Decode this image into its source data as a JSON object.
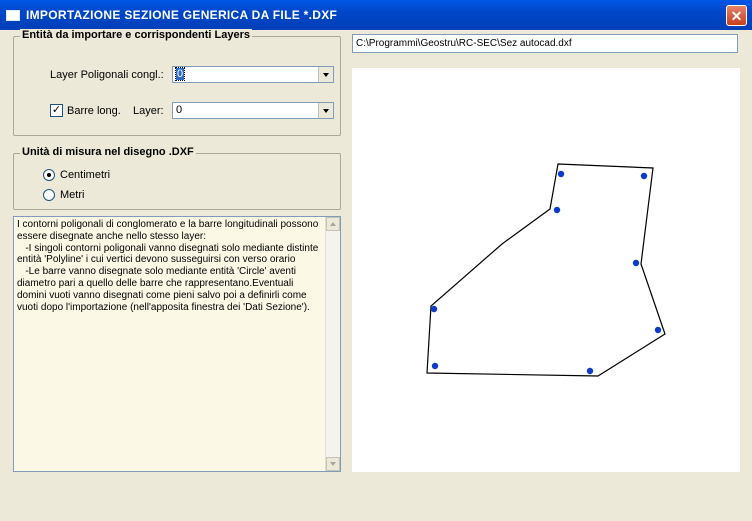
{
  "window": {
    "title": "IMPORTAZIONE  SEZIONE GENERICA  DA  FILE  *.DXF",
    "close_glyph": "✕"
  },
  "entities_group": {
    "legend": "Entità da importare e corrispondenti  Layers",
    "layer_label": "Layer Poligonali congl.:",
    "layer_value": "0",
    "bars_checkbox_label": "Barre long.",
    "bars_checked": true,
    "bars_layer_label": "Layer:",
    "bars_layer_value": "0"
  },
  "units_group": {
    "legend": "Unità di misura nel disegno .DXF",
    "options": [
      {
        "label": "Centimetri",
        "selected": true
      },
      {
        "label": "Metri",
        "selected": false
      }
    ]
  },
  "info_text": "I contorni poligonali di conglomerato e la barre longitudinali possono essere disegnate anche nello stesso layer:\n   -I singoli contorni poligonali vanno disegnati solo mediante distinte entità 'Polyline' i cui vertici devono susseguirsi con verso orario\n   -Le barre vanno disegnate solo mediante entità 'Circle' aventi diametro pari a quello delle barre che rappresentano.Eventuali domini vuoti vanno disegnati come pieni salvo poi a definirli come vuoti dopo l'importazione (nell'apposita finestra dei 'Dati Sezione').",
  "file_path": "C:\\Programmi\\Geostru\\RC-SEC\\Sez autocad.dxf",
  "colors": {
    "title_bar": "#0046c8",
    "bar_dot": "#0a3cc8",
    "outline": "#000000"
  }
}
